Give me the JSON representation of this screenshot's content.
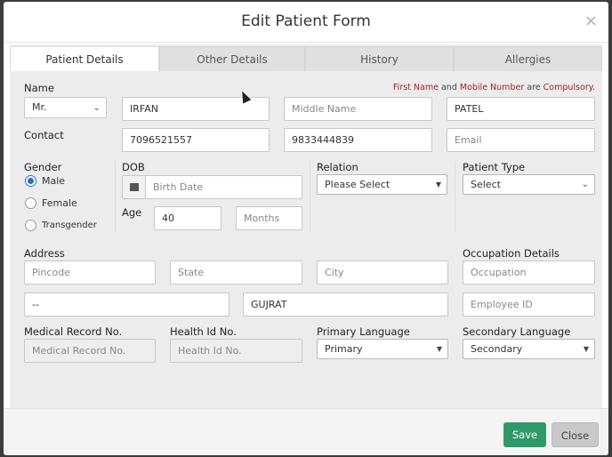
{
  "modal": {
    "title": "Edit Patient Form",
    "close_symbol": "×"
  },
  "tabs": [
    {
      "label": "Patient Details",
      "active": true
    },
    {
      "label": "Other Details",
      "active": false
    },
    {
      "label": "History",
      "active": false
    },
    {
      "label": "Allergies",
      "active": false
    }
  ],
  "notice": {
    "part1": "First Name",
    "part2": " and ",
    "part3": "Mobile Number",
    "part4": " are ",
    "part5": "Compulsory."
  },
  "name": {
    "label": "Name",
    "title": "Mr.",
    "first": "IRFAN",
    "middle_placeholder": "Middle Name",
    "last": "PATEL"
  },
  "contact": {
    "label": "Contact",
    "phone1": "7096521557",
    "phone2": "9833444839",
    "email_placeholder": "Email"
  },
  "gender": {
    "label": "Gender",
    "options": [
      "Male",
      "Female",
      "Transgender"
    ],
    "selected": "Male"
  },
  "dob": {
    "label": "DOB",
    "placeholder": "Birth Date"
  },
  "age": {
    "label": "Age",
    "value": "40",
    "months_placeholder": "Months"
  },
  "relation": {
    "label": "Relation",
    "value": "Please Select"
  },
  "patient_type": {
    "label": "Patient Type",
    "value": "Select"
  },
  "address": {
    "label": "Address",
    "pincode_placeholder": "Pincode",
    "state_placeholder": "State",
    "city_placeholder": "City",
    "line1": "--",
    "line2": "GUJRAT"
  },
  "occupation": {
    "label": "Occupation Details",
    "occupation_placeholder": "Occupation",
    "employee_placeholder": "Employee ID"
  },
  "mrn": {
    "label": "Medical Record No.",
    "placeholder": "Medical Record No."
  },
  "health_id": {
    "label": "Health Id No.",
    "placeholder": "Health Id No."
  },
  "primary_language": {
    "label": "Primary Language",
    "value": "Primary"
  },
  "secondary_language": {
    "label": "Secondary Language",
    "value": "Secondary"
  },
  "footer": {
    "save_label": "Save",
    "close_label": "Close"
  },
  "colors": {
    "accent": "#2e9a6a",
    "required_text": "#a32222",
    "radio": "#2b6cd4"
  }
}
